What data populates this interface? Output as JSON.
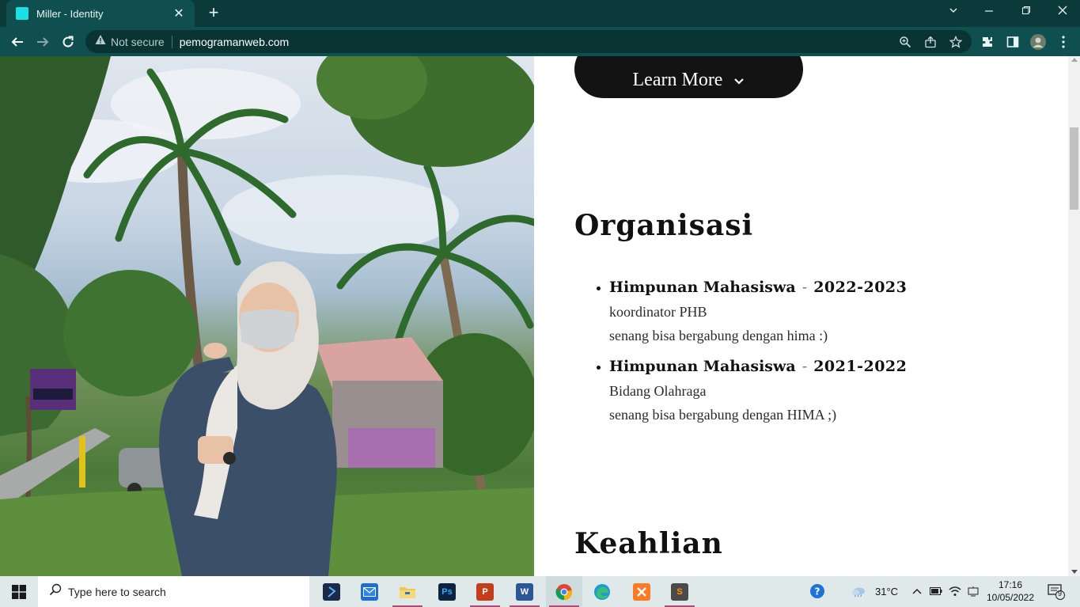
{
  "browser": {
    "tab_title": "Miller - Identity",
    "tab_close": "✕",
    "new_tab": "+",
    "security_label": "Not secure",
    "url": "pemogramanweb.com",
    "accent": "#0f4f4f"
  },
  "page": {
    "learn_more_label": "Learn More",
    "learn_more_icon": "chevron-down-icon",
    "organisasi_title": "Organisasi",
    "organisasi": [
      {
        "name": "Himpunan Mahasiswa",
        "dash": "-",
        "years": "2022-2023",
        "role": "koordinator PHB",
        "note": "senang bisa bergabung dengan hima :)"
      },
      {
        "name": "Himpunan Mahasiswa",
        "dash": "-",
        "years": "2021-2022",
        "role": "Bidang Olahraga",
        "note": "senang bisa bergabung dengan HIMA ;)"
      }
    ],
    "keahlian_title": "Keahlian"
  },
  "taskbar": {
    "search_placeholder": "Type here to search",
    "weather": "31°C",
    "time": "17:16",
    "date": "10/05/2022",
    "notification_count": "9",
    "apps": [
      {
        "name": "visual-studio",
        "label": ""
      },
      {
        "name": "mail",
        "label": ""
      },
      {
        "name": "file-explorer",
        "label": ""
      },
      {
        "name": "photoshop",
        "label": "Ps"
      },
      {
        "name": "powerpoint",
        "label": "P"
      },
      {
        "name": "word",
        "label": "W"
      },
      {
        "name": "chrome",
        "label": ""
      },
      {
        "name": "edge",
        "label": ""
      },
      {
        "name": "xampp",
        "label": ""
      },
      {
        "name": "sublime-text",
        "label": "S"
      }
    ]
  }
}
